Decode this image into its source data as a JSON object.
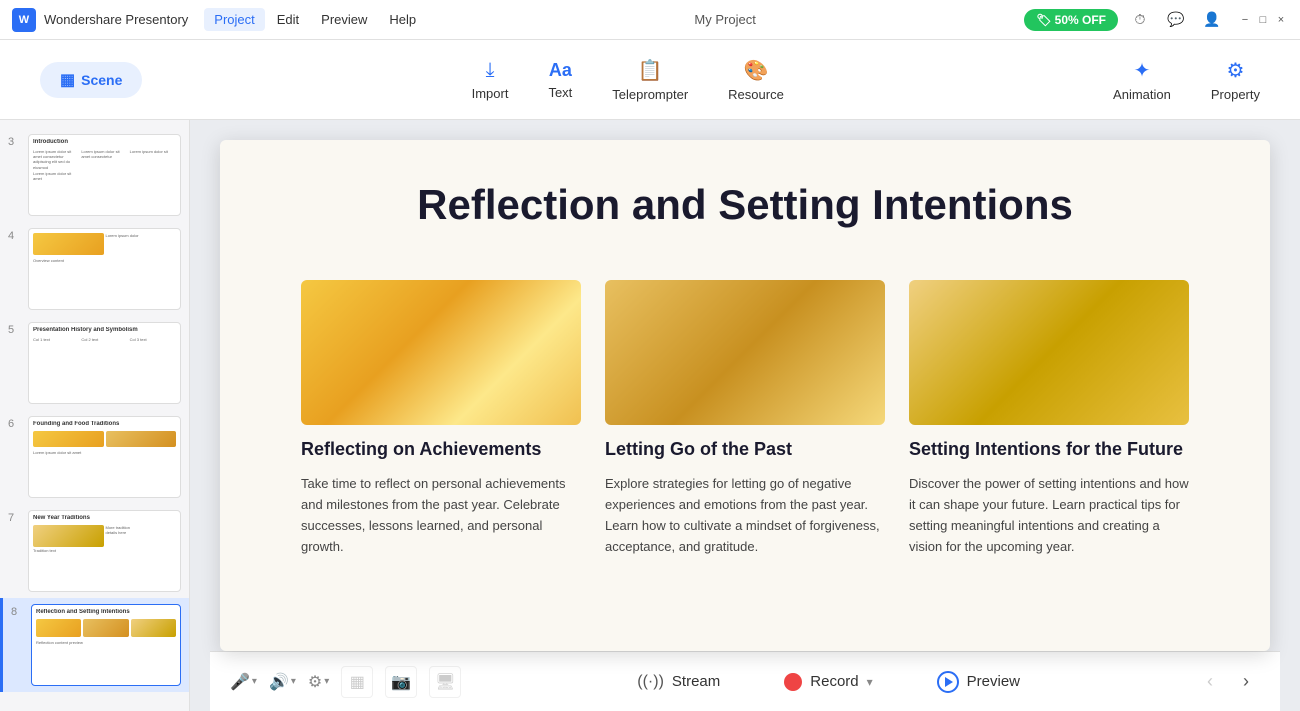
{
  "app": {
    "logo_text": "W",
    "name": "Wondershare Presentory",
    "menu_items": [
      "Project",
      "Edit",
      "Preview",
      "Help"
    ],
    "active_menu": "Project",
    "project_title": "My Project",
    "promo_label": "50% OFF",
    "window_buttons": [
      "−",
      "□",
      "×"
    ]
  },
  "toolbar": {
    "scene_label": "Scene",
    "items": [
      {
        "id": "import",
        "label": "Import",
        "icon": "📥"
      },
      {
        "id": "text",
        "label": "Text",
        "icon": "Aa"
      },
      {
        "id": "teleprompter",
        "label": "Teleprompter",
        "icon": "💬"
      },
      {
        "id": "resource",
        "label": "Resource",
        "icon": "🎨"
      },
      {
        "id": "animation",
        "label": "Animation",
        "icon": "✨"
      },
      {
        "id": "property",
        "label": "Property",
        "icon": "⚙"
      }
    ]
  },
  "sidebar": {
    "slides": [
      {
        "num": "3",
        "title": "Introduction",
        "has_text": true
      },
      {
        "num": "4",
        "title": "Overview",
        "has_img": true
      },
      {
        "num": "5",
        "title": "Presentation History and Symbol ism",
        "has_img": true
      },
      {
        "num": "6",
        "title": "Founding and Food Traditions",
        "has_img": true
      },
      {
        "num": "7",
        "title": "New Year Traditions",
        "has_img": true
      },
      {
        "num": "8",
        "title": "Reflection and Setting Intentions",
        "has_img": true,
        "active": true
      }
    ]
  },
  "slide": {
    "title": "Reflection and Setting Intentions",
    "cards": [
      {
        "title": "Reflecting on Achievements",
        "desc": "Take time to reflect on personal achievements and milestones from the past year. Celebrate successes, lessons learned, and personal growth.",
        "img_class": "img1"
      },
      {
        "title": "Letting Go of the Past",
        "desc": "Explore strategies for letting go of negative experiences and emotions from the past year. Learn how to cultivate a mindset of forgiveness, acceptance, and gratitude.",
        "img_class": "img2"
      },
      {
        "title": "Setting Intentions for the Future",
        "desc": "Discover the power of setting intentions and how it can shape your future. Learn practical tips for setting meaningful intentions and creating a vision for the upcoming year.",
        "img_class": "img3"
      }
    ]
  },
  "bottom_bar": {
    "stream_label": "Stream",
    "record_label": "Record",
    "preview_label": "Preview",
    "controls": {
      "mic_icon": "🎤",
      "volume_icon": "🔊",
      "settings_icon": "⚙",
      "camera_icon": "📹",
      "screen_icon": "🖥"
    }
  }
}
